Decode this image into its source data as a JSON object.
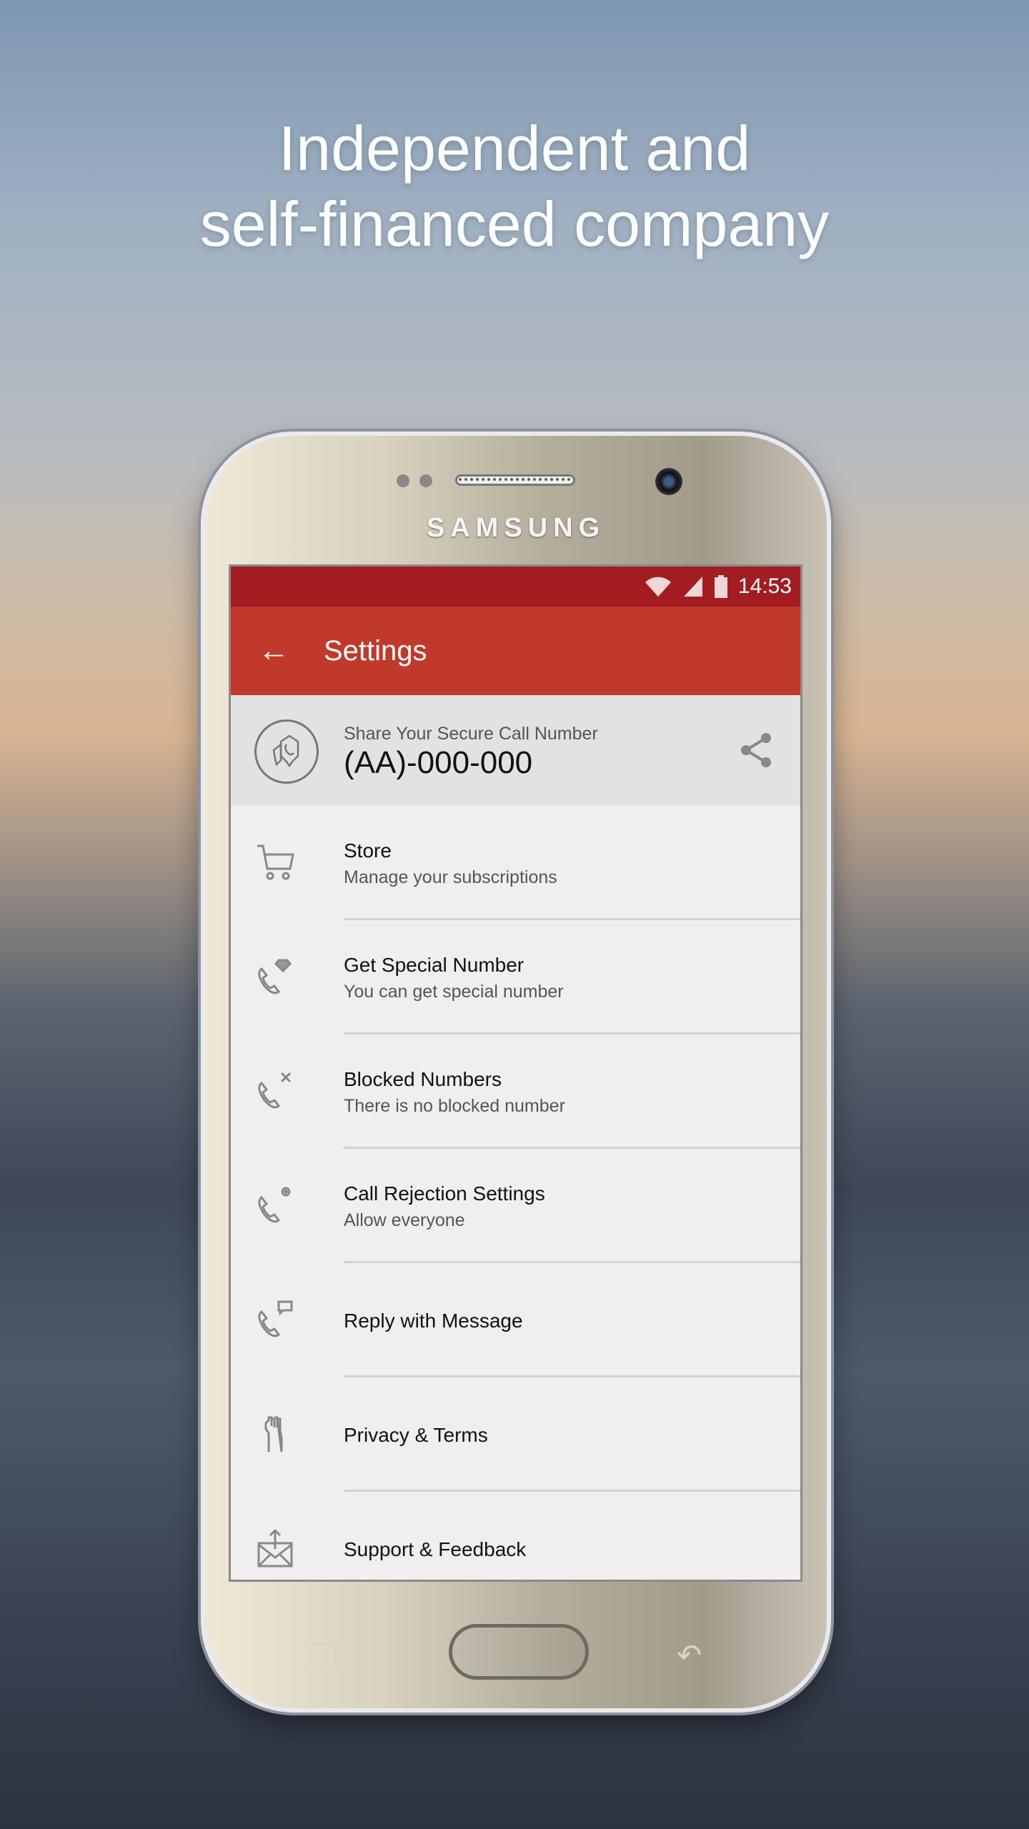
{
  "headline": {
    "line1": "Independent and",
    "line2": "self-financed company"
  },
  "phone": {
    "brand": "SAMSUNG"
  },
  "status_bar": {
    "time": "14:53",
    "icons": [
      "wifi-icon",
      "signal-icon",
      "battery-icon"
    ]
  },
  "app_bar": {
    "title": "Settings",
    "back_icon": "arrow-left-icon"
  },
  "share_header": {
    "label": "Share Your Secure Call Number",
    "number": "(AA)-000-000",
    "icon": "secure-call-shield-icon",
    "action_icon": "share-icon"
  },
  "items": [
    {
      "title": "Store",
      "subtitle": "Manage your subscriptions",
      "icon": "cart-icon"
    },
    {
      "title": "Get Special Number",
      "subtitle": "You can get special number",
      "icon": "phone-diamond-icon"
    },
    {
      "title": "Blocked Numbers",
      "subtitle": "There is no blocked number",
      "icon": "phone-block-icon"
    },
    {
      "title": "Call Rejection Settings",
      "subtitle": "Allow everyone",
      "icon": "phone-gear-icon"
    },
    {
      "title": "Reply with Message",
      "icon": "phone-message-icon"
    },
    {
      "title": "Privacy & Terms",
      "icon": "hand-icon"
    },
    {
      "title": "Support & Feedback",
      "icon": "mail-upload-icon"
    }
  ],
  "colors": {
    "status_bar": "#a31c22",
    "app_bar": "#c0392b",
    "list_bg": "#efefef",
    "header_bg": "#e2e2e2"
  }
}
